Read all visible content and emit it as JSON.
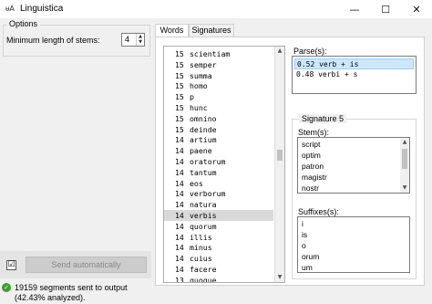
{
  "window": {
    "title": "Linguistica",
    "icon_text": "ᵾA",
    "controls": {
      "minimize": "—",
      "maximize": "☐",
      "close": "✕"
    }
  },
  "options": {
    "legend": "Options",
    "min_stem_label": "Minimum length of stems:",
    "min_stem_value": "4"
  },
  "send": {
    "checkbox_mark": "☑",
    "button_label": "Send automatically"
  },
  "status": {
    "icon": "✓",
    "text": "19159 segments sent to output (42.43% analyzed)."
  },
  "tabs": [
    {
      "label": "Words",
      "active": true
    },
    {
      "label": "Signatures",
      "active": false
    }
  ],
  "words": [
    {
      "count": "15",
      "word": "scientiam"
    },
    {
      "count": "15",
      "word": "semper"
    },
    {
      "count": "15",
      "word": "summa"
    },
    {
      "count": "15",
      "word": "homo"
    },
    {
      "count": "15",
      "word": "p"
    },
    {
      "count": "15",
      "word": "hunc"
    },
    {
      "count": "15",
      "word": "omnino"
    },
    {
      "count": "15",
      "word": "deinde"
    },
    {
      "count": "14",
      "word": "artium"
    },
    {
      "count": "14",
      "word": "paene"
    },
    {
      "count": "14",
      "word": "oratorum"
    },
    {
      "count": "14",
      "word": "tantum"
    },
    {
      "count": "14",
      "word": "eos"
    },
    {
      "count": "14",
      "word": "verborum"
    },
    {
      "count": "14",
      "word": "natura"
    },
    {
      "count": "14",
      "word": "verbis",
      "selected": true
    },
    {
      "count": "14",
      "word": "quorum"
    },
    {
      "count": "14",
      "word": "illis"
    },
    {
      "count": "14",
      "word": "minus"
    },
    {
      "count": "14",
      "word": "cuius"
    },
    {
      "count": "14",
      "word": "facere"
    },
    {
      "count": "13",
      "word": "quoque"
    }
  ],
  "words_scroll_position": 0.45,
  "parses": {
    "label": "Parse(s):",
    "items": [
      {
        "text": "0.52 verb + is",
        "selected": true
      },
      {
        "text": "0.48 verbi + s",
        "selected": false
      }
    ]
  },
  "signature": {
    "legend": "Signature 5",
    "stems_label": "Stem(s):",
    "stems": [
      "script",
      "optim",
      "patron",
      "magistr",
      "nostr"
    ],
    "suffixes_label": "Suffixes(s):",
    "suffixes": [
      "i",
      "is",
      "o",
      "orum",
      "um"
    ]
  }
}
